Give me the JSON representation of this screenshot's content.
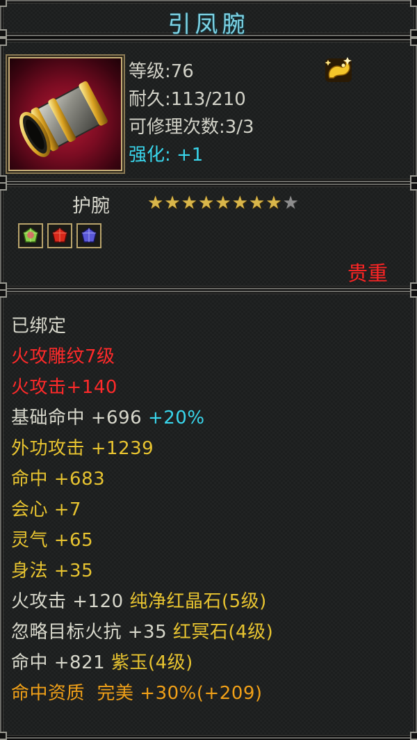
{
  "title": "引凤腕",
  "info": {
    "level": "等级:76",
    "durability": "耐久:113/210",
    "repair": "可修理次数:3/3",
    "enhance": "强化: +1",
    "badge_icon": "gold-dragon-icon",
    "item_icon": "bracer-icon"
  },
  "mid": {
    "item_type": "护腕",
    "stars_total": 9,
    "stars_filled": 8,
    "gems": [
      "green-gem-icon",
      "red-gem-icon",
      "blue-gem-icon"
    ],
    "rarity": "贵重"
  },
  "attributes": {
    "bound": "已绑定",
    "engrave": "火攻雕纹7级",
    "fire_attack": "火攻击+140",
    "base_hit": "基础命中 +696",
    "base_hit_bonus": "+20%",
    "ext_attack": "外功攻击 +1239",
    "hit": "命中 +683",
    "crit": "会心 +7",
    "spirit": "灵气 +65",
    "agility": "身法 +35",
    "gem1_stat": "火攻击 +120",
    "gem1_name": "纯净红晶石(5级)",
    "gem2_stat": "忽略目标火抗 +35",
    "gem2_name": "红冥石(4级)",
    "gem3_stat": "命中 +821",
    "gem3_name": "紫玉(4级)",
    "quality": "命中资质  完美 +30%(+209)"
  },
  "colors": {
    "title": "#7fd4e6",
    "red": "#ff2a2a",
    "cyan": "#39d6ec",
    "yellow": "#e8c430",
    "orange": "#f0a018",
    "white": "#d8d8cc"
  }
}
